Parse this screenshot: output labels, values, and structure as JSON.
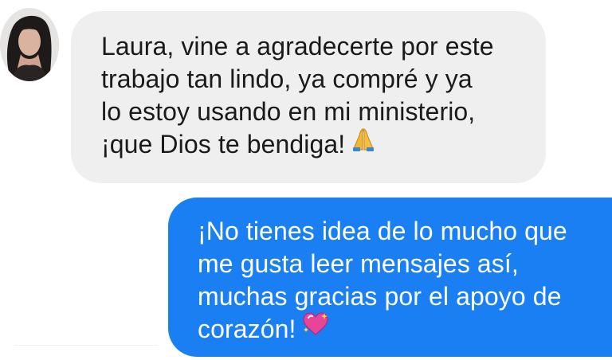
{
  "conversation": {
    "incoming": {
      "lines": [
        "Laura, vine a agradecerte por este",
        "trabajo tan lindo, ya compré y ya",
        "lo estoy usando en mi ministerio,",
        "¡que Dios te bendiga!"
      ],
      "emoji": "folded-hands-icon"
    },
    "outgoing": {
      "lines": [
        "¡No tienes idea de lo mucho que",
        "me gusta leer mensajes así,",
        "muchas gracias por el apoyo de",
        "corazón!"
      ],
      "emoji": "sparkling-heart-icon"
    }
  },
  "colors": {
    "incoming_bubble": "#efefef",
    "outgoing_bubble": "#1a7ff2",
    "incoming_text": "#1a1a1a",
    "outgoing_text": "#ffffff"
  }
}
